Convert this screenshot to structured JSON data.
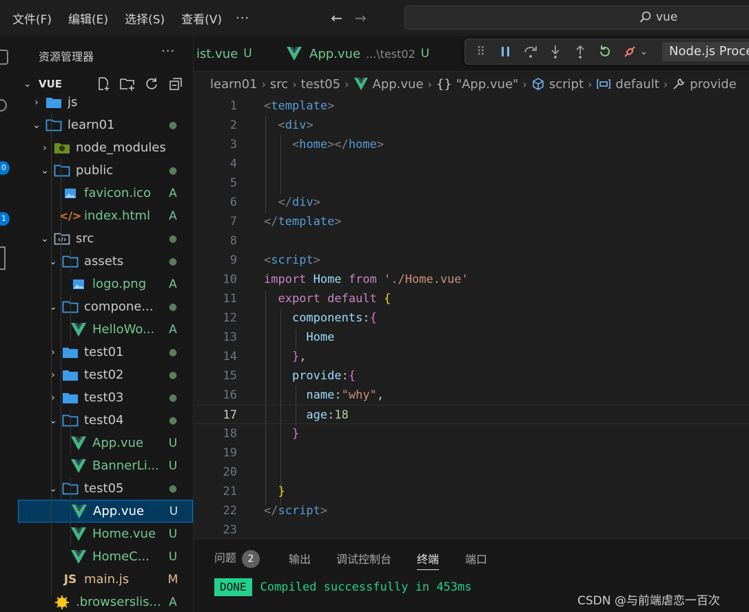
{
  "menu": [
    "文件(F)",
    "编辑(E)",
    "选择(S)",
    "查看(V)"
  ],
  "menu_more": "···",
  "search": {
    "value": "vue"
  },
  "activity": {
    "badge1": "0",
    "badge2": "1"
  },
  "sidebar": {
    "title": "资源管理器",
    "more": "···",
    "section": "VUE",
    "tree": [
      {
        "label": "js",
        "icon": "folder-icon",
        "twist": "›",
        "status": ""
      },
      {
        "label": "learn01",
        "icon": "folder-open-icon",
        "twist": "⌄",
        "status": "●"
      },
      {
        "label": "node_modules",
        "icon": "node-folder-icon",
        "twist": "›",
        "status": ""
      },
      {
        "label": "public",
        "icon": "folder-open-icon",
        "twist": "⌄",
        "status": "●"
      },
      {
        "label": "favicon.ico",
        "icon": "image-icon",
        "twist": "",
        "status": "A"
      },
      {
        "label": "index.html",
        "icon": "html-icon",
        "twist": "",
        "status": "A"
      },
      {
        "label": "src",
        "icon": "src-folder-icon",
        "twist": "⌄",
        "status": "●"
      },
      {
        "label": "assets",
        "icon": "folder-open-icon",
        "twist": "⌄",
        "status": "●"
      },
      {
        "label": "logo.png",
        "icon": "image-icon",
        "twist": "",
        "status": "A"
      },
      {
        "label": "compone...",
        "icon": "folder-open-icon",
        "twist": "⌄",
        "status": "●"
      },
      {
        "label": "HelloWo...",
        "icon": "vue-icon",
        "twist": "",
        "status": "A"
      },
      {
        "label": "test01",
        "icon": "folder-icon",
        "twist": "›",
        "status": "●"
      },
      {
        "label": "test02",
        "icon": "folder-icon",
        "twist": "›",
        "status": "●"
      },
      {
        "label": "test03",
        "icon": "folder-icon",
        "twist": "›",
        "status": "●"
      },
      {
        "label": "test04",
        "icon": "folder-open-icon",
        "twist": "⌄",
        "status": "●"
      },
      {
        "label": "App.vue",
        "icon": "vue-icon",
        "twist": "",
        "status": "U"
      },
      {
        "label": "BannerLi...",
        "icon": "vue-icon",
        "twist": "",
        "status": "U"
      },
      {
        "label": "test05",
        "icon": "folder-open-icon",
        "twist": "⌄",
        "status": "●"
      },
      {
        "label": "App.vue",
        "icon": "vue-icon",
        "twist": "",
        "status": "U"
      },
      {
        "label": "Home.vue",
        "icon": "vue-icon",
        "twist": "",
        "status": "U"
      },
      {
        "label": "HomeC...",
        "icon": "vue-icon",
        "twist": "",
        "status": "U"
      },
      {
        "label": "main.js",
        "icon": "js-icon",
        "twist": "",
        "status": "M"
      },
      {
        "label": ".browserslis...",
        "icon": "browserslist-icon",
        "twist": "",
        "status": "A"
      }
    ]
  },
  "tabs": [
    {
      "label": "ist.vue",
      "status": "U"
    },
    {
      "label": "App.vue",
      "desc": "...\\test02",
      "status": "U"
    }
  ],
  "debug": {
    "target": "Node.js Proce"
  },
  "breadcrumb": [
    "learn01",
    "src",
    "test05",
    "App.vue",
    "\"App.vue\"",
    "script",
    "default",
    "provide"
  ],
  "editor": {
    "line_numbers": [
      "1",
      "2",
      "3",
      "4",
      "5",
      "6",
      "7",
      "8",
      "9",
      "10",
      "11",
      "12",
      "13",
      "14",
      "15",
      "16",
      "17",
      "18",
      "19",
      "20",
      "21",
      "22",
      "23"
    ],
    "current_line": "17"
  },
  "panel": {
    "tabs": [
      "问题",
      "输出",
      "调试控制台",
      "终端",
      "端口"
    ],
    "problems_count": "2",
    "terminal": {
      "tag": "DONE",
      "message": "Compiled successfully in 453ms"
    }
  },
  "watermark": "CSDN @与前端虐恋一百次",
  "colors": {
    "accent": "#0078d4",
    "git_added": "#73c991",
    "git_modified": "#e2c08d",
    "terminal_green": "#23d18b",
    "vue_green": "#41b883"
  }
}
